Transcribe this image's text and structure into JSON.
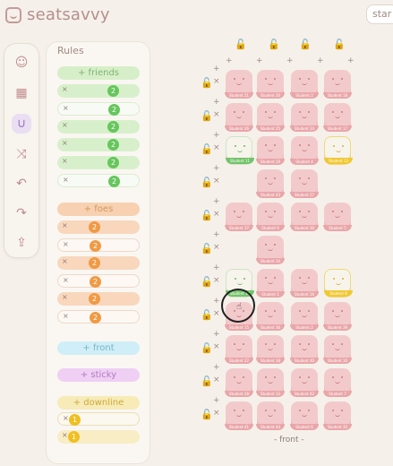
{
  "app": {
    "name": "seatsavvy",
    "start_label": "star"
  },
  "sidebar": {
    "items": [
      {
        "name": "smile-icon",
        "glyph": "☺"
      },
      {
        "name": "grid-icon",
        "glyph": "▦"
      },
      {
        "name": "magnet-icon",
        "glyph": "∪"
      },
      {
        "name": "shuffle-icon",
        "glyph": "⤨"
      },
      {
        "name": "undo-icon",
        "glyph": "↶"
      },
      {
        "name": "redo-icon",
        "glyph": "↷"
      },
      {
        "name": "share-icon",
        "glyph": "⇪"
      }
    ]
  },
  "rules": {
    "title": "Rules",
    "friends": {
      "label": "+ friends",
      "items": [
        "2",
        "2",
        "2",
        "2",
        "2",
        "2"
      ]
    },
    "foes": {
      "label": "+ foes",
      "items": [
        "2",
        "2",
        "2",
        "2",
        "2",
        "2"
      ]
    },
    "front": {
      "label": "+ front"
    },
    "sticky": {
      "label": "+ sticky"
    },
    "downline": {
      "label": "+ downline",
      "items": [
        "1",
        "1"
      ]
    }
  },
  "seating": {
    "front_label": "- front -",
    "seats": [
      [
        "Student 21",
        "Student 20",
        "Student 2",
        "Student 18"
      ],
      [
        "Student 26",
        "Student 25",
        "Student 24",
        "Student 17"
      ],
      [
        "Student 11",
        "Student 29",
        "Student 4",
        "Student 13"
      ],
      [
        "",
        "Student 43",
        "Student 27",
        ""
      ],
      [
        "Student 37",
        "Student 9",
        "Student 30",
        "Student 5"
      ],
      [
        "",
        "Student 34",
        "",
        ""
      ],
      [
        "Student 14",
        "Student 1",
        "Student 16",
        "Student 8"
      ],
      [
        "Student 15",
        "Student 36",
        "Student 2",
        "Student 39"
      ],
      [
        "Student 22",
        "Student 38",
        "Student 40",
        "Student 10"
      ],
      [
        "Student 28",
        "Student 33",
        "Student 42",
        "Student 7"
      ],
      [
        "Student 41",
        "Student 44",
        "Student 6",
        "Student 35"
      ]
    ]
  },
  "colors": {
    "seat_default": "#f3cacc",
    "seat_green": "#73c36a",
    "seat_yellow": "#f0c832",
    "friends": "#67c65d",
    "foes": "#f09a44",
    "downline": "#efbf22"
  }
}
